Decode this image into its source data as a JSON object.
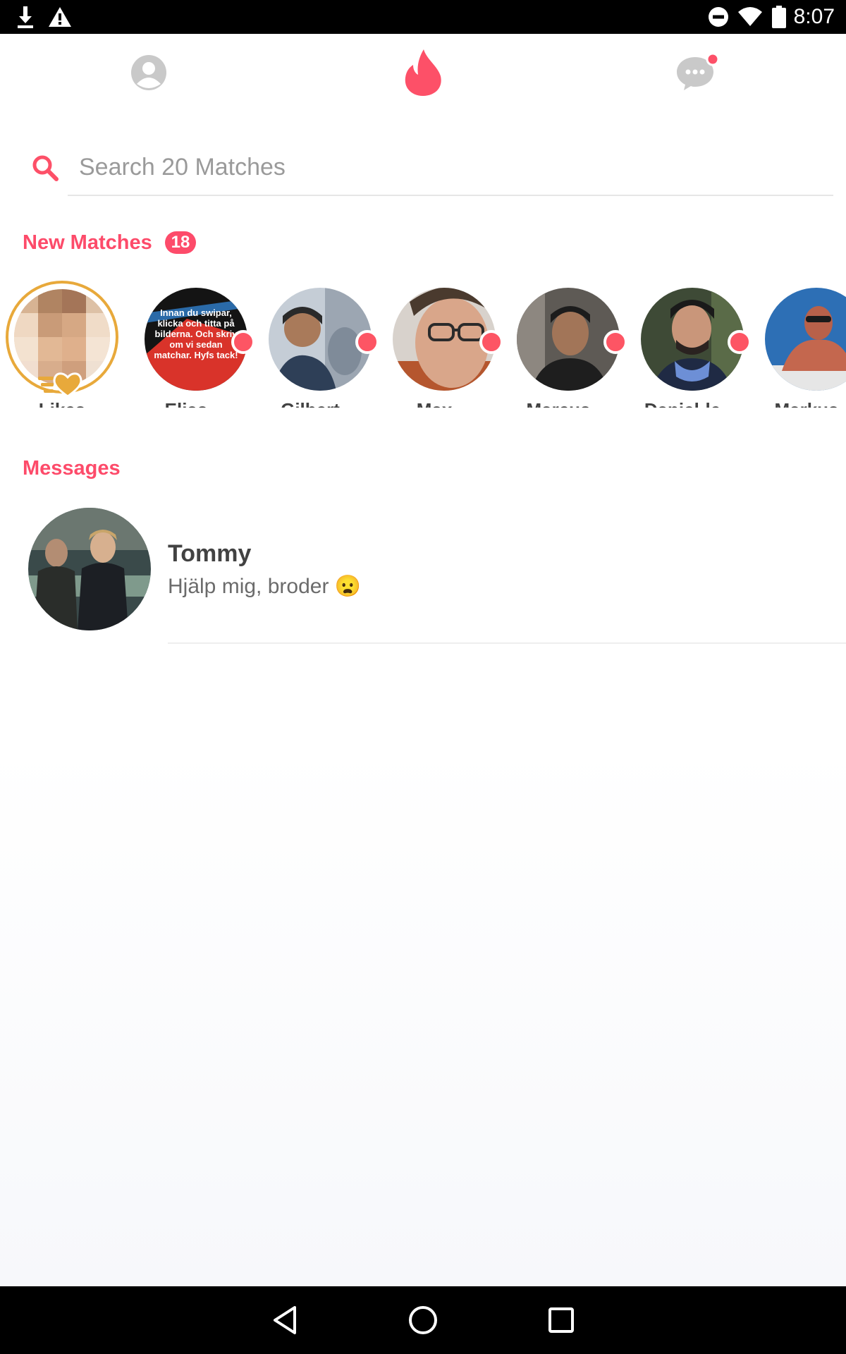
{
  "status_bar": {
    "time": "8:07",
    "left_icons": [
      "download-icon",
      "warning-icon"
    ],
    "right_icons": [
      "do-not-disturb-icon",
      "wifi-icon",
      "battery-icon"
    ]
  },
  "top_nav": {
    "items": [
      "profile-icon",
      "flame-icon",
      "messages-icon"
    ],
    "messages_has_notification": true,
    "accent_color": "#fd5068"
  },
  "search": {
    "placeholder": "Search 20 Matches",
    "value": ""
  },
  "new_matches": {
    "title": "New Matches",
    "count": "18",
    "items": [
      {
        "name": "Likes",
        "type": "likes"
      },
      {
        "name": "Elias",
        "unread": true,
        "avatar_text": "Innan du swipar, klicka och titta på bilderna. Och skriv om vi sedan matchar. Hyfs tack!"
      },
      {
        "name": "Gilbert",
        "unread": true
      },
      {
        "name": "Max",
        "unread": true
      },
      {
        "name": "Marcus",
        "unread": true
      },
      {
        "name": "Daniel-le",
        "unread": true
      },
      {
        "name": "Markus",
        "unread": true
      }
    ]
  },
  "messages": {
    "title": "Messages",
    "items": [
      {
        "name": "Tommy",
        "preview": "Hjälp mig, broder 😦"
      }
    ]
  },
  "nav_bar": {
    "items": [
      "back-icon",
      "home-icon",
      "recents-icon"
    ]
  }
}
